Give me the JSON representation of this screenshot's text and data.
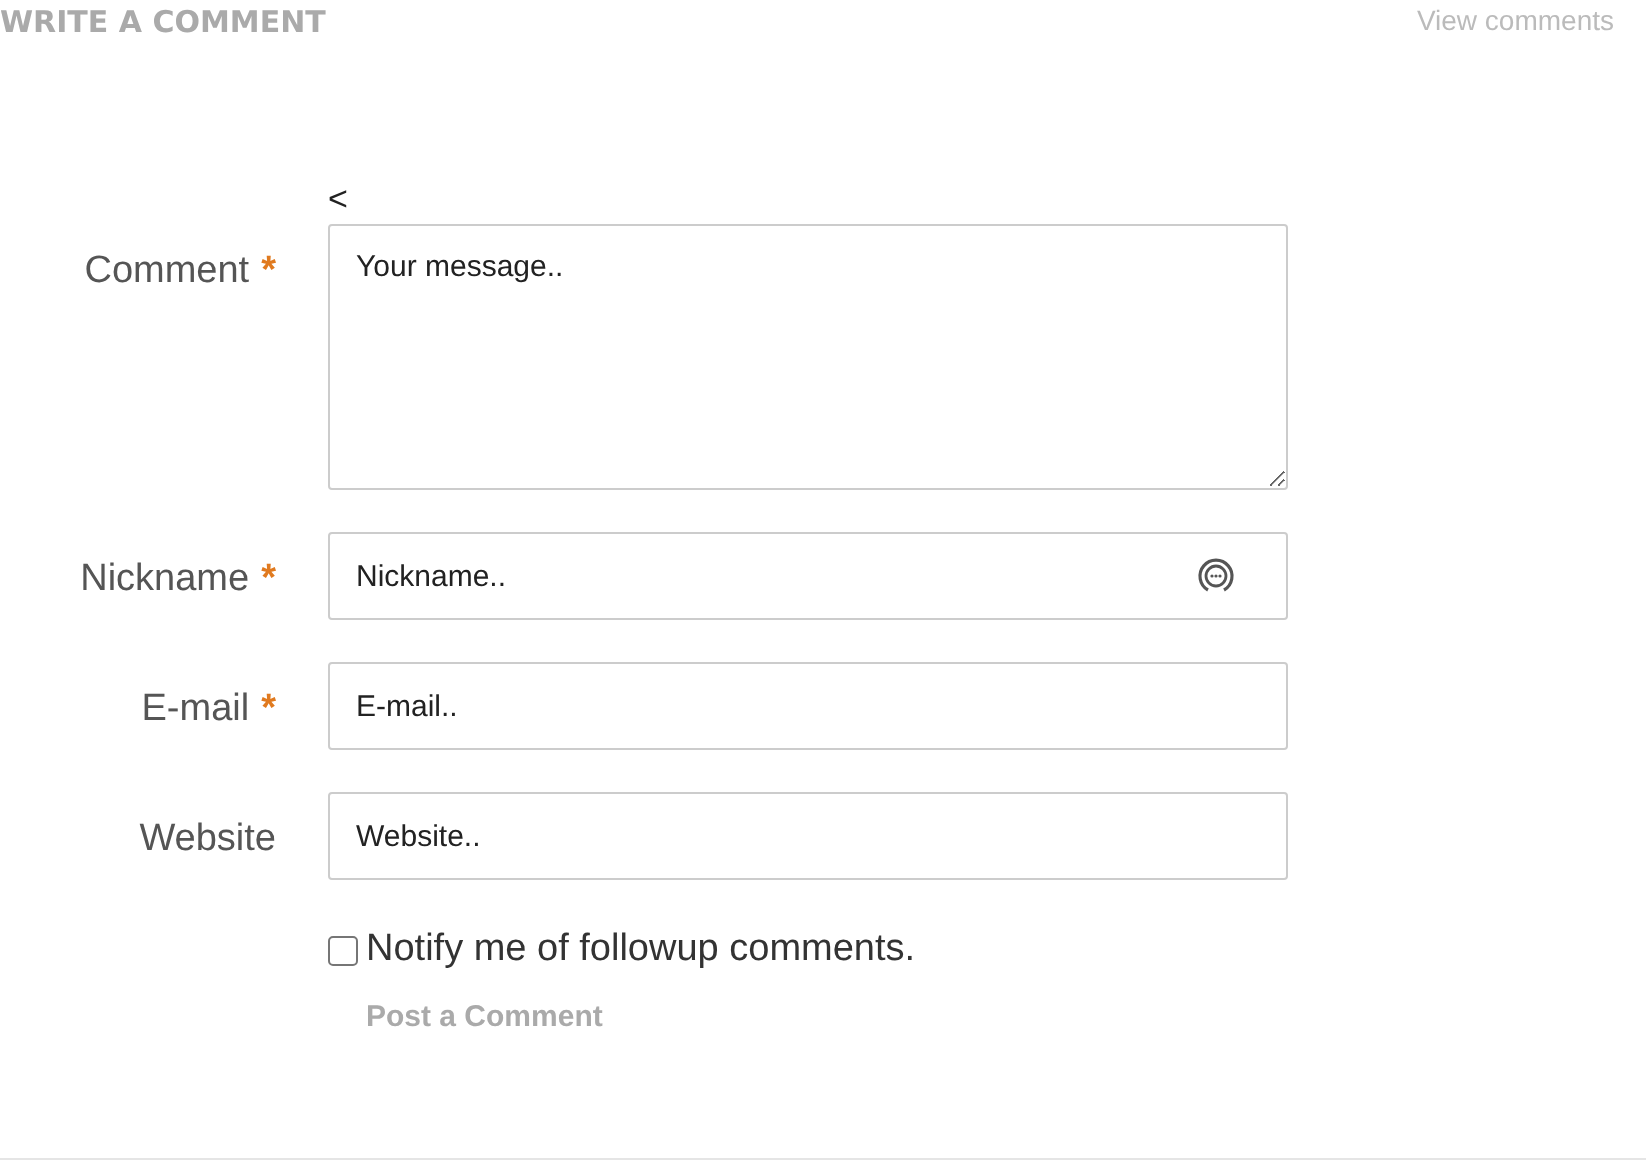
{
  "header": {
    "title": "WRITE A COMMENT",
    "link": "View comments"
  },
  "back_mark": "<",
  "fields": [
    {
      "kind": "textarea",
      "label": "Comment",
      "required": true,
      "placeholder": "Your message.."
    },
    {
      "kind": "text",
      "label": "Nickname",
      "required": true,
      "placeholder": "Nickname..",
      "icon": true
    },
    {
      "kind": "text",
      "label": "E-mail",
      "required": true,
      "placeholder": "E-mail.."
    },
    {
      "kind": "text",
      "label": "Website",
      "required": false,
      "placeholder": "Website.."
    }
  ],
  "required_mark": "*",
  "notify": {
    "label": "Notify me of followup comments.",
    "checked": false
  },
  "submit": "Post a Comment"
}
